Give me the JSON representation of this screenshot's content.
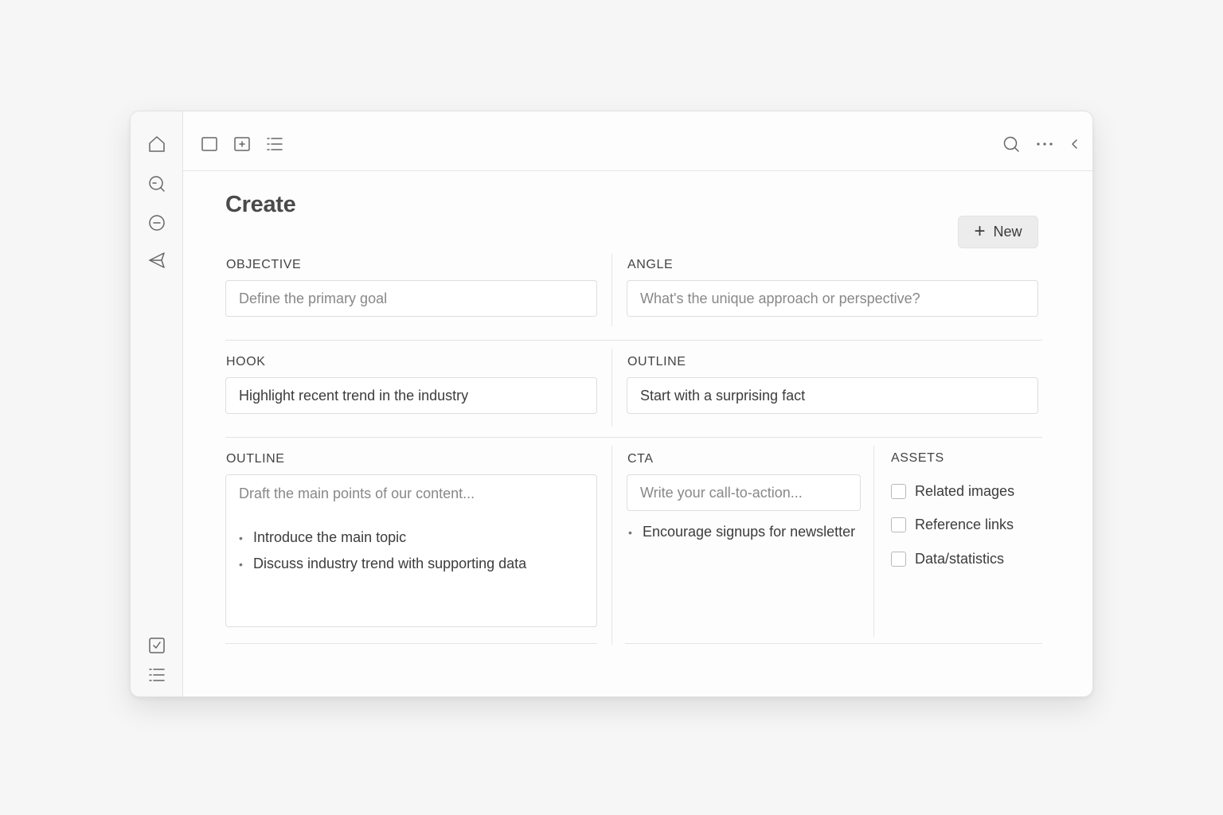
{
  "page": {
    "title": "Create",
    "new_button": "New"
  },
  "sidebar": {
    "top_icons": [
      "home-icon",
      "search-icon",
      "minus-circle-icon",
      "send-icon"
    ],
    "bottom_icons": [
      "checkbox-icon",
      "list-icon"
    ]
  },
  "toolbar": {
    "left_icons": [
      "square-icon",
      "add-box-icon",
      "list-icon"
    ],
    "right_icons": [
      "search-icon",
      "more-icon",
      "chevron-left-icon"
    ]
  },
  "objective": {
    "label": "OBJECTIVE",
    "placeholder": "Define the primary goal"
  },
  "angle": {
    "label": "ANGLE",
    "placeholder": "What's the unique approach or perspective?"
  },
  "hook": {
    "label": "HOOK",
    "value": "Highlight recent trend in the industry"
  },
  "outline_top": {
    "label": "OUTLINE",
    "value": "Start with a surprising fact"
  },
  "outline_main": {
    "label": "OUTLINE",
    "placeholder": "Draft the main points of  our content...",
    "bullets": [
      "Introduce the main topic",
      "Discuss industry trend with supporting data"
    ]
  },
  "cta": {
    "label": "CTA",
    "placeholder": "Write your call-to-action...",
    "bullets": [
      "Encourage signups for newsletter"
    ]
  },
  "assets": {
    "label": "ASSETS",
    "items": [
      {
        "label": "Related images",
        "checked": false
      },
      {
        "label": "Reference links",
        "checked": false
      },
      {
        "label": "Data/statistics",
        "checked": false
      }
    ]
  },
  "colors": {
    "background": "#f6f6f6",
    "window": "#fdfdfd",
    "button": "#ececec",
    "text": "#3c3c3c"
  }
}
